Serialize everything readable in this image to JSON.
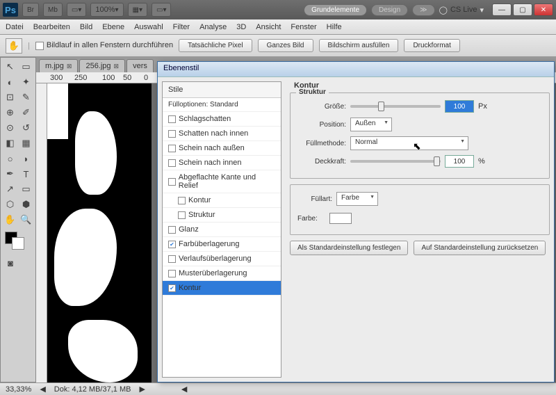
{
  "titlebar": {
    "zoom": "100%",
    "pill1": "Grundelemente",
    "pill2": "Design",
    "cslive": "CS Live"
  },
  "menu": [
    "Datei",
    "Bearbeiten",
    "Bild",
    "Ebene",
    "Auswahl",
    "Filter",
    "Analyse",
    "3D",
    "Ansicht",
    "Fenster",
    "Hilfe"
  ],
  "optbar": {
    "scroll_label": "Bildlauf in allen Fenstern durchführen",
    "b1": "Tatsächliche Pixel",
    "b2": "Ganzes Bild",
    "b3": "Bildschirm ausfüllen",
    "b4": "Druckformat"
  },
  "tabs": [
    {
      "label": "m.jpg"
    },
    {
      "label": "256.jpg"
    },
    {
      "label": "vers"
    }
  ],
  "ruler": {
    "m1": "300",
    "m2": "250",
    "m3": "100",
    "m4": "50",
    "m5": "0"
  },
  "status": {
    "zoom": "33,33%",
    "doc": "Dok: 4,12 MB/37,1 MB"
  },
  "dialog": {
    "title": "Ebenenstil",
    "list_hdr": "Stile",
    "fill_opt": "Fülloptionen: Standard",
    "items": [
      "Schlagschatten",
      "Schatten nach innen",
      "Schein nach außen",
      "Schein nach innen",
      "Abgeflachte Kante und Relief"
    ],
    "sub": [
      "Kontur",
      "Struktur"
    ],
    "items2": [
      {
        "l": "Glanz",
        "c": false
      },
      {
        "l": "Farbüberlagerung",
        "c": true
      },
      {
        "l": "Verlaufsüberlagerung",
        "c": false
      },
      {
        "l": "Musterüberlagerung",
        "c": false
      }
    ],
    "sel": "Kontur",
    "panel_title": "Kontur",
    "struct_title": "Struktur",
    "size_label": "Größe:",
    "size_val": "100",
    "size_unit": "Px",
    "pos_label": "Position:",
    "pos_val": "Außen",
    "fill_label": "Füllmethode:",
    "fill_val": "Normal",
    "opac_label": "Deckkraft:",
    "opac_val": "100",
    "opac_unit": "%",
    "fillart_label": "Füllart:",
    "fillart_val": "Farbe",
    "color_label": "Farbe:",
    "btn1": "Als Standardeinstellung festlegen",
    "btn2": "Auf Standardeinstellung zurücksetzen"
  }
}
